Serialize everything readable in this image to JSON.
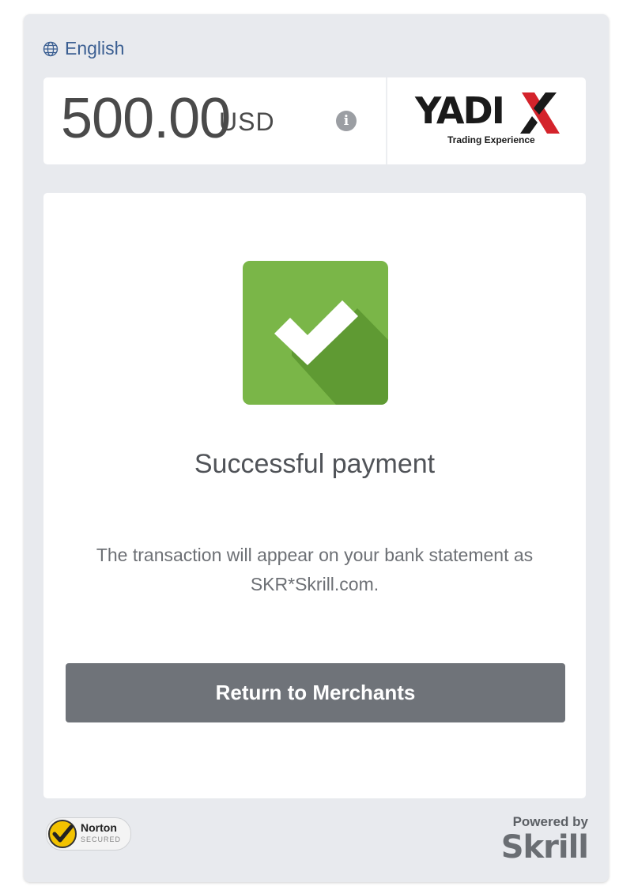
{
  "language": {
    "label": "English",
    "icon": "globe-icon"
  },
  "amount": {
    "value": "500.00",
    "currency": "USD",
    "info_icon": "i"
  },
  "merchant": {
    "logo_text": "YADI",
    "logo_x": "X",
    "tagline": "Trading Experience"
  },
  "status": {
    "title": "Successful payment",
    "description": "The transaction will appear on your bank statement as SKR*Skrill.com."
  },
  "actions": {
    "return_label": "Return to Merchants"
  },
  "footer": {
    "norton_name": "Norton",
    "norton_sub": "SECURED",
    "powered_by": "Powered by",
    "brand": "Skrill"
  },
  "colors": {
    "success_green": "#7ab648",
    "button_gray": "#6f7379",
    "link_blue": "#3b5f92",
    "logo_red": "#d4232b"
  }
}
